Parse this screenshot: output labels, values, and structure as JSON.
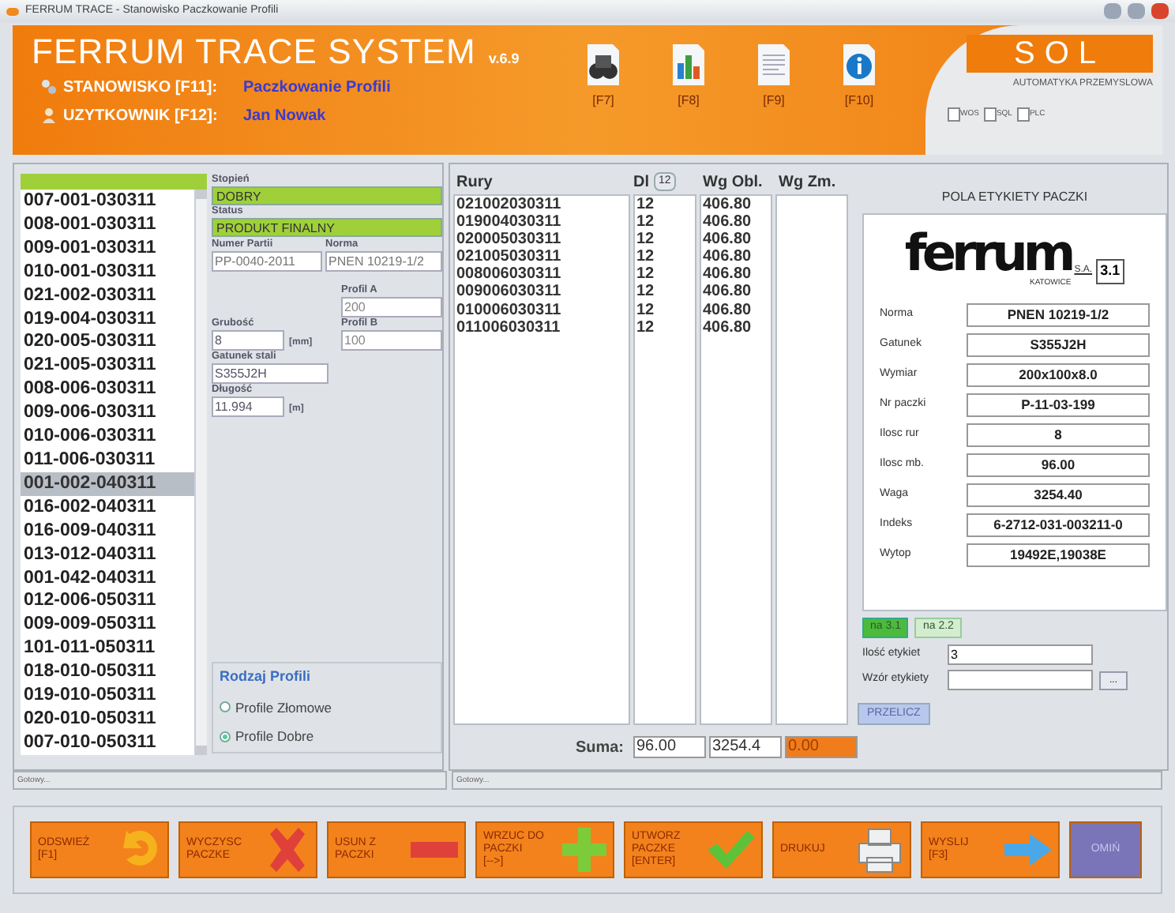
{
  "window": {
    "title": "FERRUM TRACE - Stanowisko Paczkowanie Profili"
  },
  "header": {
    "app_title": "FERRUM TRACE SYSTEM",
    "version": "v.6.9",
    "info": [
      {
        "label": "STANOWISKO [F11]:",
        "value": "Paczkowanie Profili",
        "kind": "gear"
      },
      {
        "label": "UZYTKOWNIK [F12]:",
        "value": "Jan Nowak",
        "kind": "user"
      }
    ],
    "tools": [
      {
        "label": "[F7]",
        "kind": "binoculars"
      },
      {
        "label": "[F8]",
        "kind": "chart"
      },
      {
        "label": "[F9]",
        "kind": "document"
      },
      {
        "label": "[F10]",
        "kind": "info"
      }
    ],
    "logo": {
      "name": "SOL",
      "tagline": "AUTOMATYKA PRZEMYSLOWA"
    },
    "indicators": [
      {
        "label": "WOS",
        "checked": false
      },
      {
        "label": "SQL",
        "checked": false
      },
      {
        "label": "PLC",
        "checked": false
      }
    ]
  },
  "profile_list": [
    {
      "label": "007-001-030311",
      "selected": false
    },
    {
      "label": "008-001-030311",
      "selected": false
    },
    {
      "label": "009-001-030311",
      "selected": false
    },
    {
      "label": "010-001-030311",
      "selected": false
    },
    {
      "label": "021-002-030311",
      "selected": false
    },
    {
      "label": "019-004-030311",
      "selected": false
    },
    {
      "label": "020-005-030311",
      "selected": false
    },
    {
      "label": "021-005-030311",
      "selected": false
    },
    {
      "label": "008-006-030311",
      "selected": false
    },
    {
      "label": "009-006-030311",
      "selected": false
    },
    {
      "label": "010-006-030311",
      "selected": false
    },
    {
      "label": "011-006-030311",
      "selected": false
    },
    {
      "label": "001-002-040311",
      "selected": true
    },
    {
      "label": "016-002-040311",
      "selected": false
    },
    {
      "label": "016-009-040311",
      "selected": false
    },
    {
      "label": "013-012-040311",
      "selected": false
    },
    {
      "label": "001-042-040311",
      "selected": false
    },
    {
      "label": "012-006-050311",
      "selected": false
    },
    {
      "label": "009-009-050311",
      "selected": false
    },
    {
      "label": "101-011-050311",
      "selected": false
    },
    {
      "label": "018-010-050311",
      "selected": false
    },
    {
      "label": "019-010-050311",
      "selected": false
    },
    {
      "label": "020-010-050311",
      "selected": false
    },
    {
      "label": "007-010-050311",
      "selected": false
    }
  ],
  "details": {
    "stopien": {
      "label": "Stopień",
      "value": "DOBRY"
    },
    "status": {
      "label": "Status",
      "value": "PRODUKT FINALNY"
    },
    "numer_partii": {
      "label": "Numer Partii",
      "value": "PP-0040-2011"
    },
    "norma": {
      "label": "Norma",
      "value": "PNEN 10219-1/2"
    },
    "profil_a": {
      "label": "Profil A",
      "value": "200"
    },
    "profil_b": {
      "label": "Profil B",
      "value": "100"
    },
    "grubosc": {
      "label": "Grubość",
      "value": "8",
      "unit": "[mm]"
    },
    "gatunek": {
      "label": "Gatunek stali",
      "value": "S355J2H"
    },
    "dlugosc": {
      "label": "Długość",
      "value": "11.994",
      "unit": "[m]"
    },
    "rodzaj": {
      "title": "Rodzaj Profili",
      "options": [
        {
          "label": "Profile Złomowe",
          "selected": false
        },
        {
          "label": "Profile Dobre",
          "selected": true
        }
      ]
    }
  },
  "left_status": "Gotowy...",
  "pipes": {
    "columns": [
      "Rury",
      "Dl",
      "Wg Obl.",
      "Wg Zm."
    ],
    "dl_filter": "12",
    "rows": [
      [
        "021002030311",
        "12",
        "406.80"
      ],
      [
        "019004030311",
        "12",
        "406.80"
      ],
      [
        "020005030311",
        "12",
        "406.80"
      ],
      [
        "021005030311",
        "12",
        "406.80"
      ],
      [
        "008006030311",
        "12",
        "406.80"
      ],
      [
        "009006030311",
        "12",
        "406.80"
      ],
      [
        "010006030311",
        "12",
        "406.80"
      ],
      [
        "011006030311",
        "12",
        "406.80"
      ]
    ],
    "sum_label": "Suma:",
    "sums": [
      "96.00",
      "3254.4",
      "0.00"
    ]
  },
  "label_panel": {
    "title": "POLA ETYKIETY PACZKI",
    "brand": "ferrum",
    "brand_suffix": "S.A.",
    "brand_city": "KATOWICE",
    "certificate": "3.1",
    "fields": [
      {
        "label": "Norma",
        "value": "PNEN 10219-1/2"
      },
      {
        "label": "Gatunek",
        "value": "S355J2H"
      },
      {
        "label": "Wymiar",
        "value": "200x100x8.0"
      },
      {
        "label": "Nr paczki",
        "value": "P-11-03-199"
      },
      {
        "label": "Ilosc rur",
        "value": "8"
      },
      {
        "label": "Ilosc mb.",
        "value": "96.00"
      },
      {
        "label": "Waga",
        "value": "3254.40"
      },
      {
        "label": "Indeks",
        "value": "6-2712-031-003211-0"
      },
      {
        "label": "Wytop",
        "value": "19492E,19038E"
      }
    ],
    "tabs": [
      {
        "label": "na 3.1",
        "selected": true
      },
      {
        "label": "na 2.2",
        "selected": false
      }
    ],
    "ilosc_etykiet": {
      "label": "Ilość etykiet",
      "value": "3"
    },
    "wzor_etykiety": {
      "label": "Wzór etykiety",
      "browse": "..."
    },
    "recalc": "PRZELICZ"
  },
  "right_status": "Gotowy...",
  "actions": [
    {
      "label": "ODSWIEŻ\n[F1]",
      "kind": "refresh"
    },
    {
      "label": "WYCZYSC\nPACZKE",
      "kind": "clear"
    },
    {
      "label": "USUN Z\nPACZKI",
      "kind": "remove"
    },
    {
      "label": "WRZUC DO\nPACZKI\n[-->]",
      "kind": "add"
    },
    {
      "label": "UTWORZ\nPACZKE\n[ENTER]",
      "kind": "create"
    },
    {
      "label": "DRUKUJ",
      "kind": "print"
    },
    {
      "label": "WYSLIJ\n[F3]",
      "kind": "send"
    },
    {
      "label": "OMIŃ",
      "kind": "skip"
    }
  ]
}
